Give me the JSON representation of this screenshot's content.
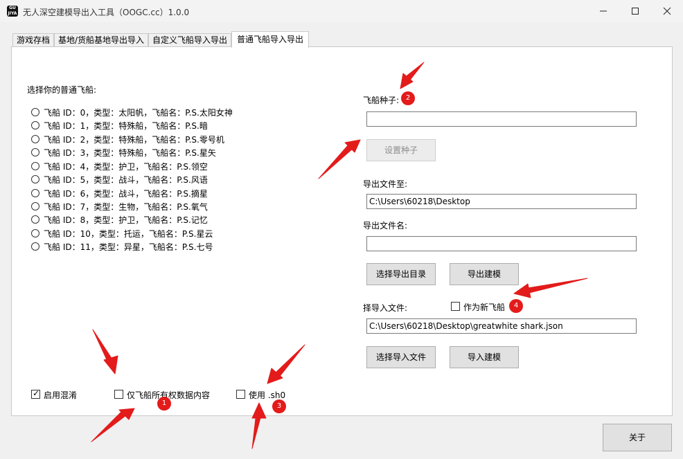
{
  "window": {
    "title": "无人深空建模导出入工具（OOGC.cc）1.0.0",
    "icon_text": "GU\nJIYA"
  },
  "tabs": [
    {
      "label": "游戏存档",
      "active": false
    },
    {
      "label": "基地/货船基地导出导入",
      "active": false
    },
    {
      "label": "自定义飞船导入导出",
      "active": false
    },
    {
      "label": "普通飞船导入导出",
      "active": true
    }
  ],
  "left": {
    "heading": "选择你的普通飞船:",
    "ships": [
      "飞船 ID：0，类型：太阳帆，飞船名：P.S.太阳女神",
      "飞船 ID：1，类型：特殊船，飞船名：P.S.暗",
      "飞船 ID：2，类型：特殊船，飞船名：P.S.零号机",
      "飞船 ID：3，类型：特殊船，飞船名：P.S.星矢",
      "飞船 ID：4，类型：护卫，飞船名：P.S.领空",
      "飞船 ID：5，类型：战斗，飞船名：P.S.风语",
      "飞船 ID：6，类型：战斗，飞船名：P.S.摘星",
      "飞船 ID：7，类型：生物，飞船名：P.S.氧气",
      "飞船 ID：8，类型：护卫，飞船名：P.S.记忆",
      "飞船 ID：10，类型：托运，飞船名：P.S.星云",
      "飞船 ID：11，类型：异星，飞船名：P.S.七号"
    ],
    "opt_obfuscate": "启用混淆",
    "opt_obfuscate_checked": true,
    "opt_owner_only": "仅飞船所有权数据内容",
    "opt_owner_only_checked": false,
    "opt_sh0": "使用 .sh0",
    "opt_sh0_checked": false
  },
  "right": {
    "seed_label": "飞船种子:",
    "seed_value": "",
    "set_seed_button": "设置种子",
    "export_dir_label": "导出文件至:",
    "export_dir_value": "C:\\Users\\60218\\Desktop",
    "export_name_label": "导出文件名:",
    "export_name_value": "",
    "choose_export_dir_button": "选择导出目录",
    "export_model_button": "导出建模",
    "import_file_label": "择导入文件:",
    "as_new_ship_label": "作为新飞船",
    "as_new_ship_checked": false,
    "import_file_value": "C:\\Users\\60218\\Desktop\\greatwhite shark.json",
    "choose_import_file_button": "选择导入文件",
    "import_model_button": "导入建模"
  },
  "about_button": "关于",
  "badges": [
    "1",
    "2",
    "3",
    "4"
  ],
  "colors": {
    "annotation_red": "#e31b1b",
    "panel_bg": "#ffffff",
    "window_bg": "#f0f0f0"
  }
}
